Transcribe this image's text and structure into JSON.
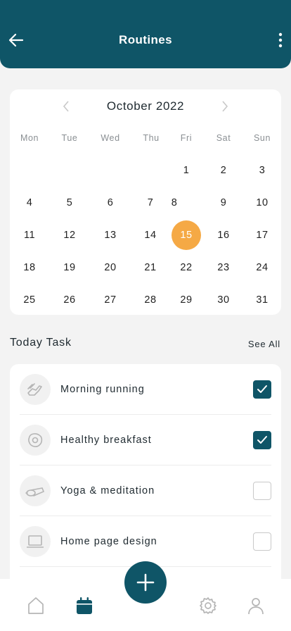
{
  "header": {
    "title": "Routines"
  },
  "calendar": {
    "month_label": "October 2022",
    "weekdays": [
      "Mon",
      "Tue",
      "Wed",
      "Thu",
      "Fri",
      "Sat",
      "Sun"
    ],
    "days": [
      "1",
      "2",
      "3",
      "4",
      "5",
      "6",
      "7",
      "8",
      "9",
      "10",
      "11",
      "12",
      "13",
      "14",
      "15",
      "16",
      "17",
      "18",
      "19",
      "20",
      "21",
      "22",
      "23",
      "24",
      "25",
      "26",
      "27",
      "28",
      "29",
      "30",
      "31"
    ],
    "selected_day": "15",
    "selected_color": "#f5a945"
  },
  "today": {
    "title": "Today Task",
    "see_all": "See All"
  },
  "tasks": [
    {
      "label": "Morning running",
      "icon": "running-shoe-icon",
      "checked": true
    },
    {
      "label": "Healthy breakfast",
      "icon": "egg-icon",
      "checked": true
    },
    {
      "label": "Yoga & meditation",
      "icon": "yoga-mat-icon",
      "checked": false
    },
    {
      "label": "Home page design",
      "icon": "laptop-icon",
      "checked": false
    }
  ],
  "colors": {
    "primary": "#0f5567",
    "accent": "#f5a945"
  },
  "nav": [
    "home-icon",
    "calendar-icon",
    "add-icon",
    "settings-icon",
    "profile-icon"
  ]
}
